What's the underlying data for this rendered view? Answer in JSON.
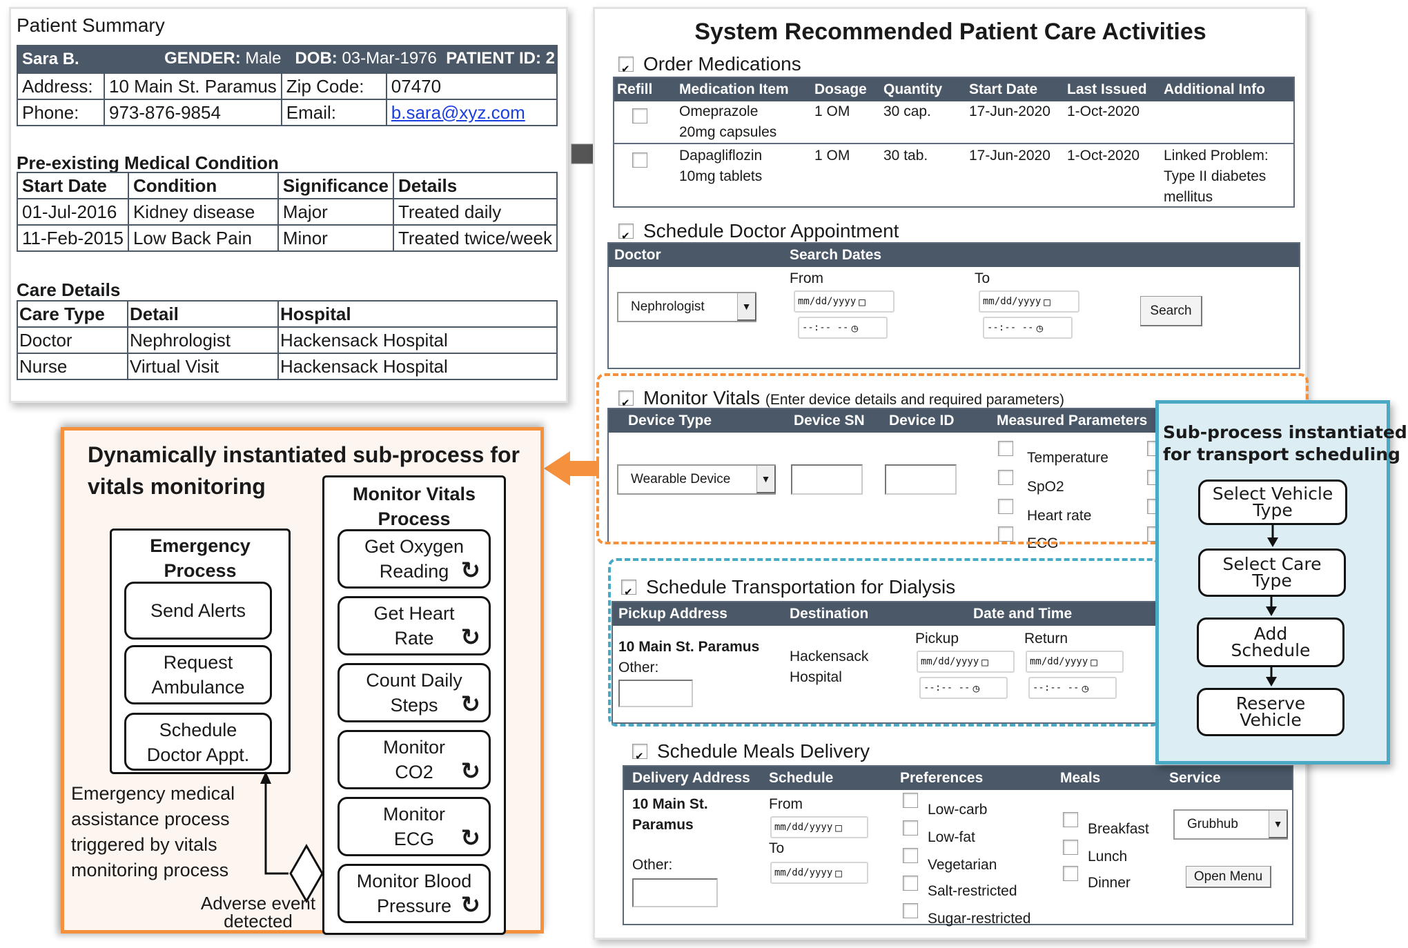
{
  "patient_summary": {
    "title": "Patient Summary",
    "name": "Sara B.",
    "gender_label": "GENDER:",
    "gender": "Male",
    "dob_label": "DOB:",
    "dob": "03-Mar-1976",
    "patient_id_label": "PATIENT ID:",
    "patient_id": "2",
    "address_label": "Address:",
    "address": "10 Main St. Paramus",
    "zip_label": "Zip Code:",
    "zip": "07470",
    "phone_label": "Phone:",
    "phone": "973-876-9854",
    "email_label": "Email:",
    "email": "b.sara@xyz.com",
    "conditions": {
      "title": "Pre-existing Medical Condition",
      "headers": [
        "Start Date",
        "Condition",
        "Significance",
        "Details"
      ],
      "rows": [
        [
          "01-Jul-2016",
          "Kidney disease",
          "Major",
          "Treated daily"
        ],
        [
          "11-Feb-2015",
          "Low Back Pain",
          "Minor",
          "Treated twice/week"
        ]
      ]
    },
    "care": {
      "title": "Care Details",
      "headers": [
        "Care Type",
        "Detail",
        "Hospital"
      ],
      "rows": [
        [
          "Doctor",
          "Nephrologist",
          "Hackensack Hospital"
        ],
        [
          "Nurse",
          "Virtual Visit",
          "Hackensack Hospital"
        ]
      ]
    }
  },
  "activities": {
    "title": "System Recommended Patient Care Activities",
    "order_medications": {
      "label": "Order Medications",
      "checked": true,
      "headers": [
        "Refill",
        "Medication Item",
        "Dosage",
        "Quantity",
        "Start Date",
        "Last Issued",
        "Additional Info"
      ],
      "rows": [
        {
          "item": "Omeprazole",
          "item2": "20mg capsules",
          "dosage": "1 OM",
          "quantity": "30 cap.",
          "start": "17-Jun-2020",
          "last": "1-Oct-2020",
          "info": "",
          "info2": "",
          "info3": ""
        },
        {
          "item": "Dapagliflozin",
          "item2": "10mg tablets",
          "dosage": "1 OM",
          "quantity": "30 tab.",
          "start": "17-Jun-2020",
          "last": "1-Oct-2020",
          "info": "Linked Problem:",
          "info2": "Type II diabetes",
          "info3": "mellitus"
        }
      ]
    },
    "doctor_appointment": {
      "label": "Schedule Doctor Appointment",
      "checked": true,
      "header_doctor": "Doctor",
      "header_dates": "Search Dates",
      "doctor_value": "Nephrologist",
      "from_label": "From",
      "to_label": "To",
      "date_placeholder": "mm/dd/yyyy",
      "time_placeholder": "--:-- --",
      "search_button": "Search"
    },
    "monitor_vitals": {
      "label": "Monitor Vitals",
      "sublabel": "(Enter device details and required parameters)",
      "checked": true,
      "headers": [
        "Device Type",
        "Device SN",
        "Device ID",
        "Measured Parameters"
      ],
      "device_type": "Wearable Device",
      "parameters": [
        "Temperature",
        "SpO2",
        "Heart rate",
        "ECG"
      ]
    },
    "transportation": {
      "label": "Schedule Transportation for Dialysis",
      "checked": true,
      "headers": [
        "Pickup Address",
        "Destination",
        "Date and Time"
      ],
      "pickup_address": "10 Main St. Paramus",
      "other_label": "Other:",
      "destination_line1": "Hackensack",
      "destination_line2": "Hospital",
      "pickup_label": "Pickup",
      "return_label": "Return"
    },
    "meals": {
      "label": "Schedule Meals Delivery",
      "checked": true,
      "headers": [
        "Delivery Address",
        "Schedule",
        "Preferences",
        "Meals",
        "Service"
      ],
      "address_line1": "10 Main St.",
      "address_line2": "Paramus",
      "other_label": "Other:",
      "from_label": "From",
      "to_label": "To",
      "preferences": [
        "Low-carb",
        "Low-fat",
        "Vegetarian",
        "Salt-restricted",
        "Sugar-restricted"
      ],
      "meals": [
        "Breakfast",
        "Lunch",
        "Dinner"
      ],
      "service": "Grubhub",
      "open_menu_button": "Open Menu"
    }
  },
  "transport_subprocess": {
    "title_line1": "Sub-process instantiated",
    "title_line2": "for transport scheduling",
    "steps": [
      {
        "line1": "Select Vehicle",
        "line2": "Type"
      },
      {
        "line1": "Select Care",
        "line2": "Type"
      },
      {
        "line1": "Add",
        "line2": "Schedule"
      },
      {
        "line1": "Reserve",
        "line2": "Vehicle"
      }
    ]
  },
  "vitals_subprocess": {
    "title_line1": "Dynamically instantiated sub-process for",
    "title_line2": "vitals monitoring",
    "emergency": {
      "title_line1": "Emergency",
      "title_line2": "Process",
      "steps": [
        {
          "line1": "Send Alerts",
          "line2": ""
        },
        {
          "line1": "Request",
          "line2": "Ambulance"
        },
        {
          "line1": "Schedule",
          "line2": "Doctor Appt."
        }
      ]
    },
    "monitor": {
      "title_line1": "Monitor Vitals",
      "title_line2": "Process",
      "steps": [
        {
          "line1": "Get Oxygen",
          "line2": "Reading"
        },
        {
          "line1": "Get Heart",
          "line2": "Rate"
        },
        {
          "line1": "Count Daily",
          "line2": "Steps"
        },
        {
          "line1": "Monitor",
          "line2": "CO2"
        },
        {
          "line1": "Monitor",
          "line2": "ECG"
        },
        {
          "line1": "Monitor Blood",
          "line2": "Pressure"
        }
      ]
    },
    "annotation": [
      "Emergency medical",
      "assistance process",
      "triggered by vitals",
      "monitoring process"
    ],
    "gateway_label_line1": "Adverse event",
    "gateway_label_line2": "detected"
  },
  "colors": {
    "table_header": "#4a5868",
    "orange_accent": "#f5913c",
    "blue_accent": "#4aaac6",
    "blue_fill": "#dcedf4",
    "orange_fill": "#fdf5f0",
    "link": "#1a3fe0"
  }
}
